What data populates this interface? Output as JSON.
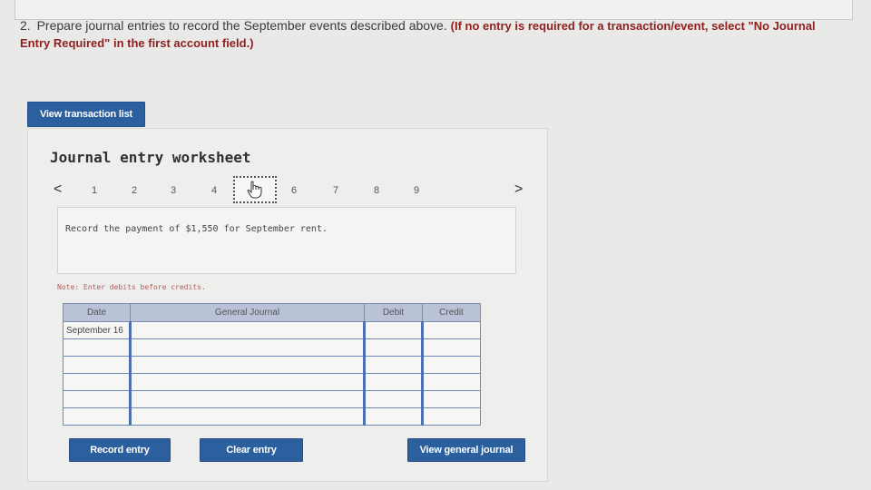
{
  "instructions": {
    "number": "2.",
    "text": "Prepare journal entries to record the September events described above.",
    "emphasis": "(If no entry is required for a transaction/event, select \"No Journal Entry Required\" in the first account field.)"
  },
  "buttons": {
    "view_transaction_list": "View transaction list",
    "record_entry": "Record entry",
    "clear_entry": "Clear entry",
    "view_general_journal": "View general journal"
  },
  "worksheet": {
    "title": "Journal entry worksheet",
    "pager": {
      "prev_label": "<",
      "next_label": ">",
      "pages": [
        "1",
        "2",
        "3",
        "4",
        "5",
        "6",
        "7",
        "8",
        "9"
      ],
      "active_page": 5,
      "cursor_icon": "hand-pointer-icon"
    },
    "prompt": "Record the payment of $1,550 for September rent.",
    "note": "Note: Enter debits before credits.",
    "table": {
      "headers": [
        "Date",
        "General Journal",
        "Debit",
        "Credit"
      ],
      "rows": [
        {
          "date": "September 16",
          "account": "",
          "debit": "",
          "credit": ""
        },
        {
          "date": "",
          "account": "",
          "debit": "",
          "credit": ""
        },
        {
          "date": "",
          "account": "",
          "debit": "",
          "credit": ""
        },
        {
          "date": "",
          "account": "",
          "debit": "",
          "credit": ""
        },
        {
          "date": "",
          "account": "",
          "debit": "",
          "credit": ""
        },
        {
          "date": "",
          "account": "",
          "debit": "",
          "credit": ""
        }
      ]
    }
  },
  "colors": {
    "button_blue": "#2b5f9e",
    "header_bg": "#b9c2d6",
    "emphasis_red": "#8f1f1f"
  }
}
